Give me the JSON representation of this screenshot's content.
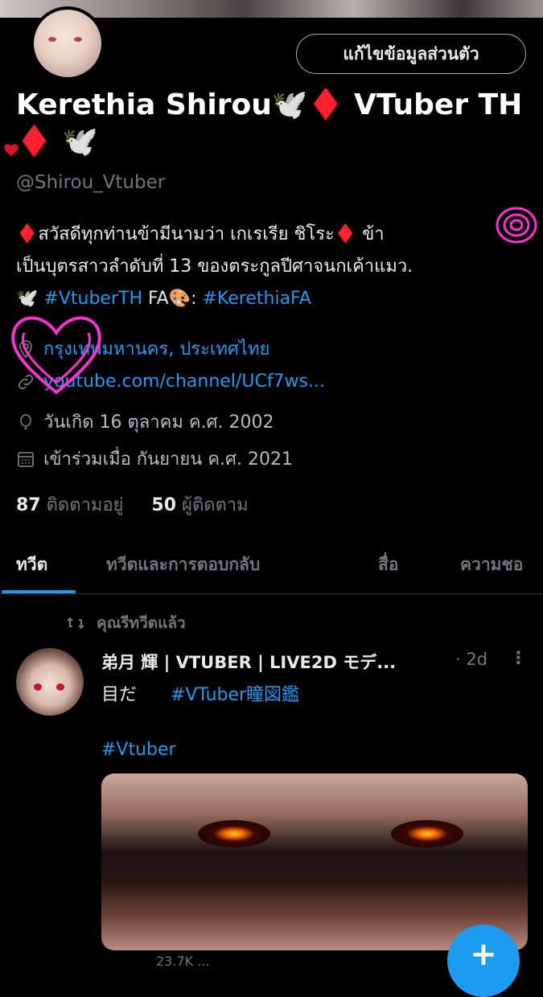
{
  "profile": {
    "edit_button": "แก้ไขข้อมูลส่วนตัว",
    "name": "Kerethia Shirou🕊️♦️ VTuber TH ♦️ 🕊️",
    "handle": "@Shirou_Vtuber",
    "bio_line1": "♦️สวัสดีทุกท่านข้ามีนามว่า เกเรเรีย ชิโระ♦️ ข้า",
    "bio_line2": "เป็นบุตรสาวลำดับที่ 13 ของตระกูลปีศาจนกเค้าแมว.",
    "bio_dove": "🕊️",
    "bio_tag1": "#VtuberTH",
    "bio_fa": "FA🎨:",
    "bio_tag2": "#KerethiaFA",
    "location": "กรุงเทพมหานคร, ประเทศไทย",
    "website": "youtube.com/channel/UCf7ws...",
    "birthday": "วันเกิด 16 ตุลาคม ค.ศ. 2002",
    "joined": "เข้าร่วมเมื่อ กันยายน ค.ศ. 2021",
    "following_count": "87",
    "following_label": "ติดตามอยู่",
    "followers_count": "50",
    "followers_label": "ผู้ติดตาม"
  },
  "tabs": [
    {
      "label": "ทวีต"
    },
    {
      "label": "ทวีตและการตอบกลับ"
    },
    {
      "label": "สื่อ"
    },
    {
      "label": "ความชอ"
    }
  ],
  "tweet": {
    "retweet_label": "คุณรีทวีตแล้ว",
    "author": "弟月 輝 | VTUBER | LIVE2D モデ...",
    "time": "· 2d",
    "more": "⋮",
    "text": "目だ",
    "tag1": "#VTuber瞳図鑑",
    "tag2": "#Vtuber",
    "partial_stat": "23.7K ..."
  },
  "fab": {
    "label": "+"
  },
  "colors": {
    "accent": "#1d9bf0",
    "background": "#000000",
    "muted": "#71767b"
  },
  "icons": [
    "location-icon",
    "link-icon",
    "birthday-icon",
    "calendar-icon",
    "retweet-icon"
  ]
}
